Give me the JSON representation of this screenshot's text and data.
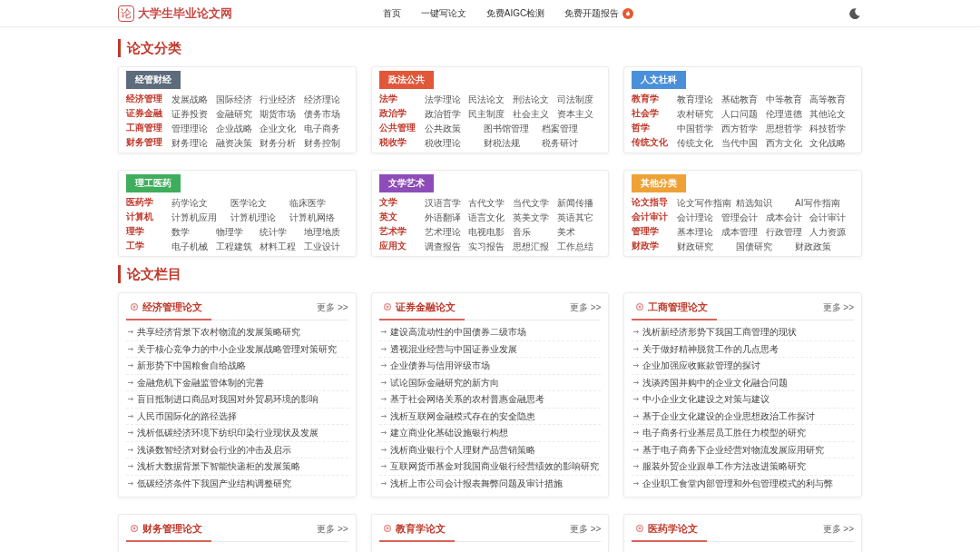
{
  "header": {
    "logo_mark": "论",
    "site_name": "大学生毕业论文网",
    "nav": [
      {
        "label": "首页",
        "hot": false
      },
      {
        "label": "一键写论文",
        "hot": false
      },
      {
        "label": "免费AIGC检测",
        "hot": false
      },
      {
        "label": "免费开题报告",
        "hot": true
      }
    ]
  },
  "category_section": {
    "title": "论文分类",
    "groups": [
      {
        "tag": "经管财经",
        "color": "#5d6b7b",
        "rows": [
          {
            "label": "经济管理",
            "links": [
              "发展战略",
              "国际经济",
              "行业经济",
              "经济理论"
            ]
          },
          {
            "label": "证券金融",
            "links": [
              "证券投资",
              "金融研究",
              "期货市场",
              "债务市场"
            ]
          },
          {
            "label": "工商管理",
            "links": [
              "管理理论",
              "企业战略",
              "企业文化",
              "电子商务"
            ]
          },
          {
            "label": "财务管理",
            "links": [
              "财务理论",
              "融资决策",
              "财务分析",
              "财务控制"
            ]
          }
        ]
      },
      {
        "tag": "政法公共",
        "color": "#e0573a",
        "rows": [
          {
            "label": "法学",
            "links": [
              "法学理论",
              "民法论文",
              "刑法论文",
              "司法制度"
            ]
          },
          {
            "label": "政治学",
            "links": [
              "政治哲学",
              "民主制度",
              "社会主义",
              "资本主义"
            ]
          },
          {
            "label": "公共管理",
            "links": [
              "公共政策",
              "图书馆管理",
              "档案管理"
            ]
          },
          {
            "label": "税收学",
            "links": [
              "税收理论",
              "财税法规",
              "税务研讨"
            ]
          }
        ]
      },
      {
        "tag": "人文社科",
        "color": "#4a90d9",
        "rows": [
          {
            "label": "教育学",
            "links": [
              "教育理论",
              "基础教育",
              "中等教育",
              "高等教育"
            ]
          },
          {
            "label": "社会学",
            "links": [
              "农村研究",
              "人口问题",
              "伦理道德",
              "其他论文"
            ]
          },
          {
            "label": "哲学",
            "links": [
              "中国哲学",
              "西方哲学",
              "思想哲学",
              "科技哲学"
            ]
          },
          {
            "label": "传统文化",
            "links": [
              "传统文化",
              "当代中国",
              "西方文化",
              "文化战略"
            ]
          }
        ]
      },
      {
        "tag": "理工医药",
        "color": "#3fae5c",
        "rows": [
          {
            "label": "医药学",
            "links": [
              "药学论文",
              "医学论文",
              "临床医学"
            ]
          },
          {
            "label": "计算机",
            "links": [
              "计算机应用",
              "计算机理论",
              "计算机网络"
            ]
          },
          {
            "label": "理学",
            "links": [
              "数学",
              "物理学",
              "统计学",
              "地理地质"
            ]
          },
          {
            "label": "工学",
            "links": [
              "电子机械",
              "工程建筑",
              "材料工程",
              "工业设计"
            ]
          }
        ]
      },
      {
        "tag": "文学艺术",
        "color": "#8e4cb8",
        "rows": [
          {
            "label": "文学",
            "links": [
              "汉语言学",
              "古代文学",
              "当代文学",
              "新闻传播"
            ]
          },
          {
            "label": "英文",
            "links": [
              "外语翻译",
              "语言文化",
              "英美文学",
              "英语其它"
            ]
          },
          {
            "label": "艺术学",
            "links": [
              "艺术理论",
              "电视电影",
              "音乐",
              "美术"
            ]
          },
          {
            "label": "应用文",
            "links": [
              "调查报告",
              "实习报告",
              "思想汇报",
              "工作总结"
            ]
          }
        ]
      },
      {
        "tag": "其他分类",
        "color": "#eea235",
        "rows": [
          {
            "label": "论文指导",
            "links": [
              "论文写作指南",
              "精选知识",
              "AI写作指南"
            ]
          },
          {
            "label": "会计审计",
            "links": [
              "会计理论",
              "管理会计",
              "成本会计",
              "会计审计"
            ]
          },
          {
            "label": "管理学",
            "links": [
              "基本理论",
              "成本管理",
              "行政管理",
              "人力资源"
            ]
          },
          {
            "label": "财政学",
            "links": [
              "财政研究",
              "国债研究",
              "财政政策"
            ]
          }
        ]
      }
    ]
  },
  "column_section": {
    "title": "论文栏目",
    "columns": [
      {
        "title": "经济管理论文",
        "more": "更多 >>",
        "articles": [
          "共享经济背景下农村物流的发展策略研究",
          "关于核心竞争力的中小企业发展战略管理对策研究",
          "新形势下中国粮食自给战略",
          "金融危机下金融监管体制的完善",
          "盲目抵制进口商品对我国对外贸易环境的影响",
          "人民币国际化的路径选择",
          "浅析低碳经济环境下纺织印染行业现状及发展",
          "浅谈数智经济对财会行业的冲击及启示",
          "浅析大数据背景下智能快递柜的发展策略",
          "低碳经济条件下我国产业结构调整研究"
        ]
      },
      {
        "title": "证券金融论文",
        "more": "更多 >>",
        "articles": [
          "建设高流动性的中国债券二级市场",
          "透视混业经营与中国证券业发展",
          "企业债券与信用评级市场",
          "试论国际金融研究的新方向",
          "基于社会网络关系的农村普惠金融思考",
          "浅析互联网金融模式存在的安全隐患",
          "建立商业化基础设施银行构想",
          "浅析商业银行个人理财产品营销策略",
          "互联网货币基金对我国商业银行经营绩效的影响研究",
          "浅析上市公司会计报表舞弊问题及审计措施"
        ]
      },
      {
        "title": "工商管理论文",
        "more": "更多 >>",
        "articles": [
          "浅析新经济形势下我国工商管理的现状",
          "关于做好精神脱贫工作的几点思考",
          "企业加强应收账款管理的探讨",
          "浅谈跨国并购中的企业文化融合问题",
          "中小企业文化建设之对策与建议",
          "基于企业文化建设的企业思想政治工作探讨",
          "电子商务行业基层员工胜任力模型的研究",
          "基于电子商务下企业经营对物流发展应用研究",
          "服装外贸企业跟单工作方法改进策略研究",
          "企业职工食堂内部管理和外包管理模式的利与弊"
        ]
      },
      {
        "title": "财务管理论文",
        "more": "更多 >>"
      },
      {
        "title": "教育学论文",
        "more": "更多 >>"
      },
      {
        "title": "医药学论文",
        "more": "更多 >>"
      }
    ]
  }
}
